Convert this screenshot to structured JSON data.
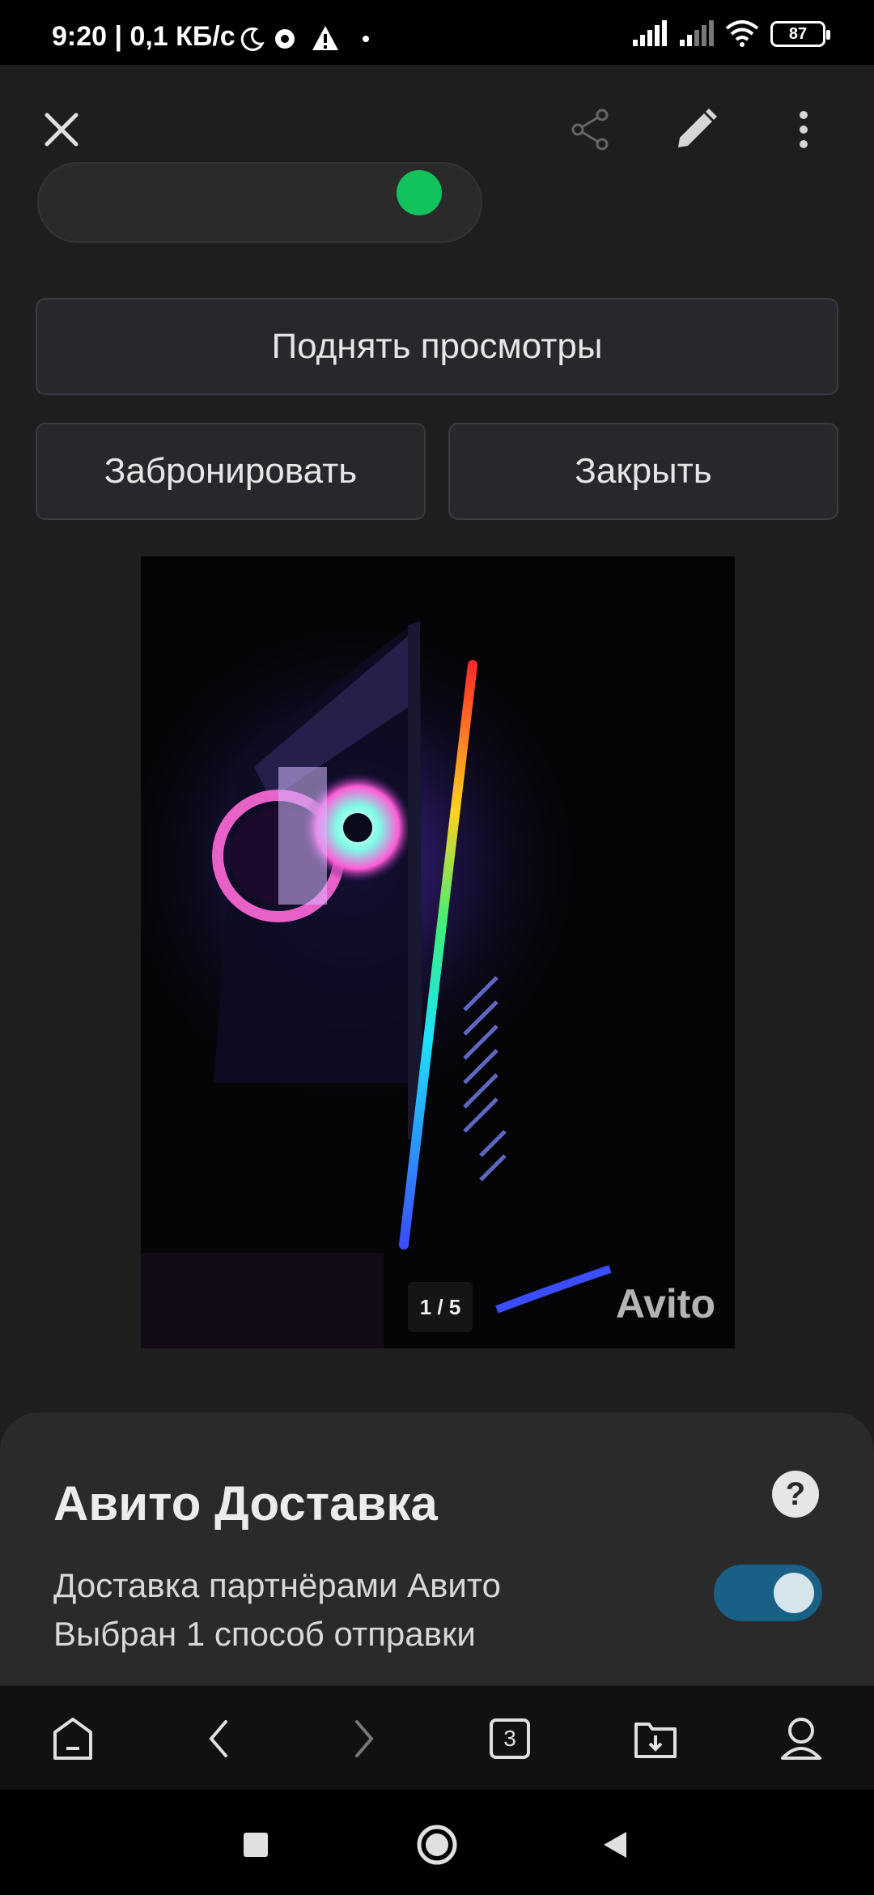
{
  "status_bar": {
    "time_and_speed": "9:20 | 0,1 КБ/с",
    "battery": "87"
  },
  "toolbar": {
    "close_icon": "close-icon",
    "share_icon": "share-icon",
    "edit_icon": "pencil-icon",
    "more_icon": "more-vert-icon"
  },
  "actions": {
    "boost_label": "Поднять просмотры",
    "reserve_label": "Забронировать",
    "close_label": "Закрыть"
  },
  "gallery": {
    "counter": "1 / 5",
    "watermark": "Avito"
  },
  "delivery": {
    "title": "Авито Доставка",
    "help": "?",
    "line1": "Доставка партнёрами Авито",
    "line2": "Выбран 1 способ отправки",
    "toggle_on": true
  },
  "browser_bar": {
    "tabs_count": "3"
  },
  "colors": {
    "accent_green": "#12c25a",
    "toggle_blue": "#1a5f86",
    "sheet_bg": "#2a2a2a",
    "app_bg": "#1e1e1e"
  }
}
